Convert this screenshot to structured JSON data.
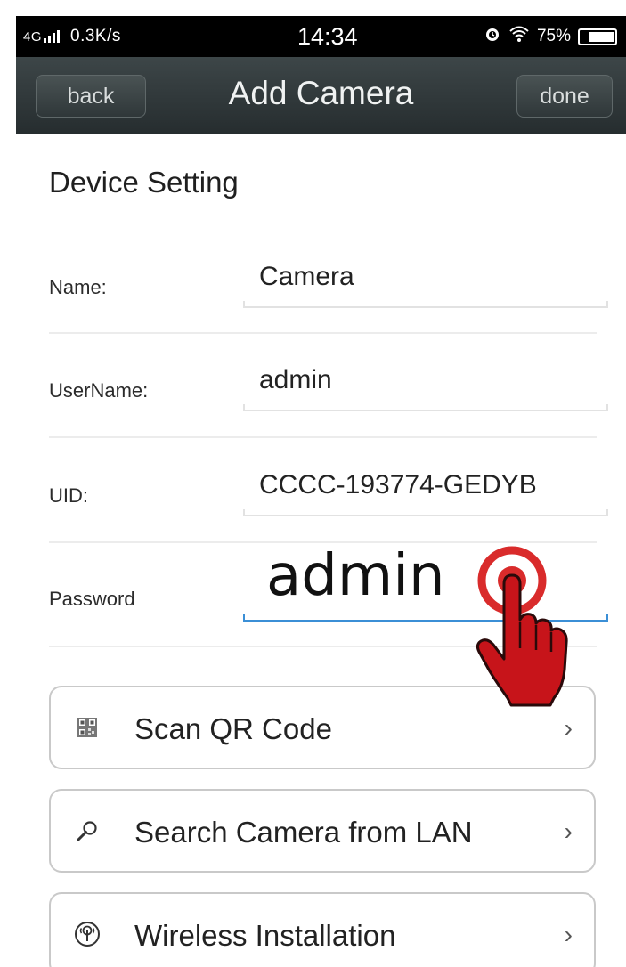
{
  "status_bar": {
    "network": "4G",
    "speed": "0.3K/s",
    "time": "14:34",
    "battery": "75%",
    "battery_level": 0.75
  },
  "nav": {
    "back_label": "back",
    "title": "Add Camera",
    "done_label": "done"
  },
  "section_title": "Device Setting",
  "form": {
    "name": {
      "label": "Name:",
      "value": "Camera"
    },
    "username": {
      "label": "UserName:",
      "value": "admin"
    },
    "uid": {
      "label": "UID:",
      "value": "CCCC-193774-GEDYB"
    },
    "password": {
      "label": "Password",
      "value": "admin"
    }
  },
  "actions": [
    {
      "label": "Scan QR Code",
      "icon": "qr-code-icon"
    },
    {
      "label": "Search Camera from LAN",
      "icon": "search-icon"
    },
    {
      "label": "Wireless Installation",
      "icon": "wireless-icon"
    }
  ],
  "colors": {
    "nav_background": "#2d3537",
    "active_field": "#3b8fd6",
    "tap_indicator": "#d92b2b"
  }
}
